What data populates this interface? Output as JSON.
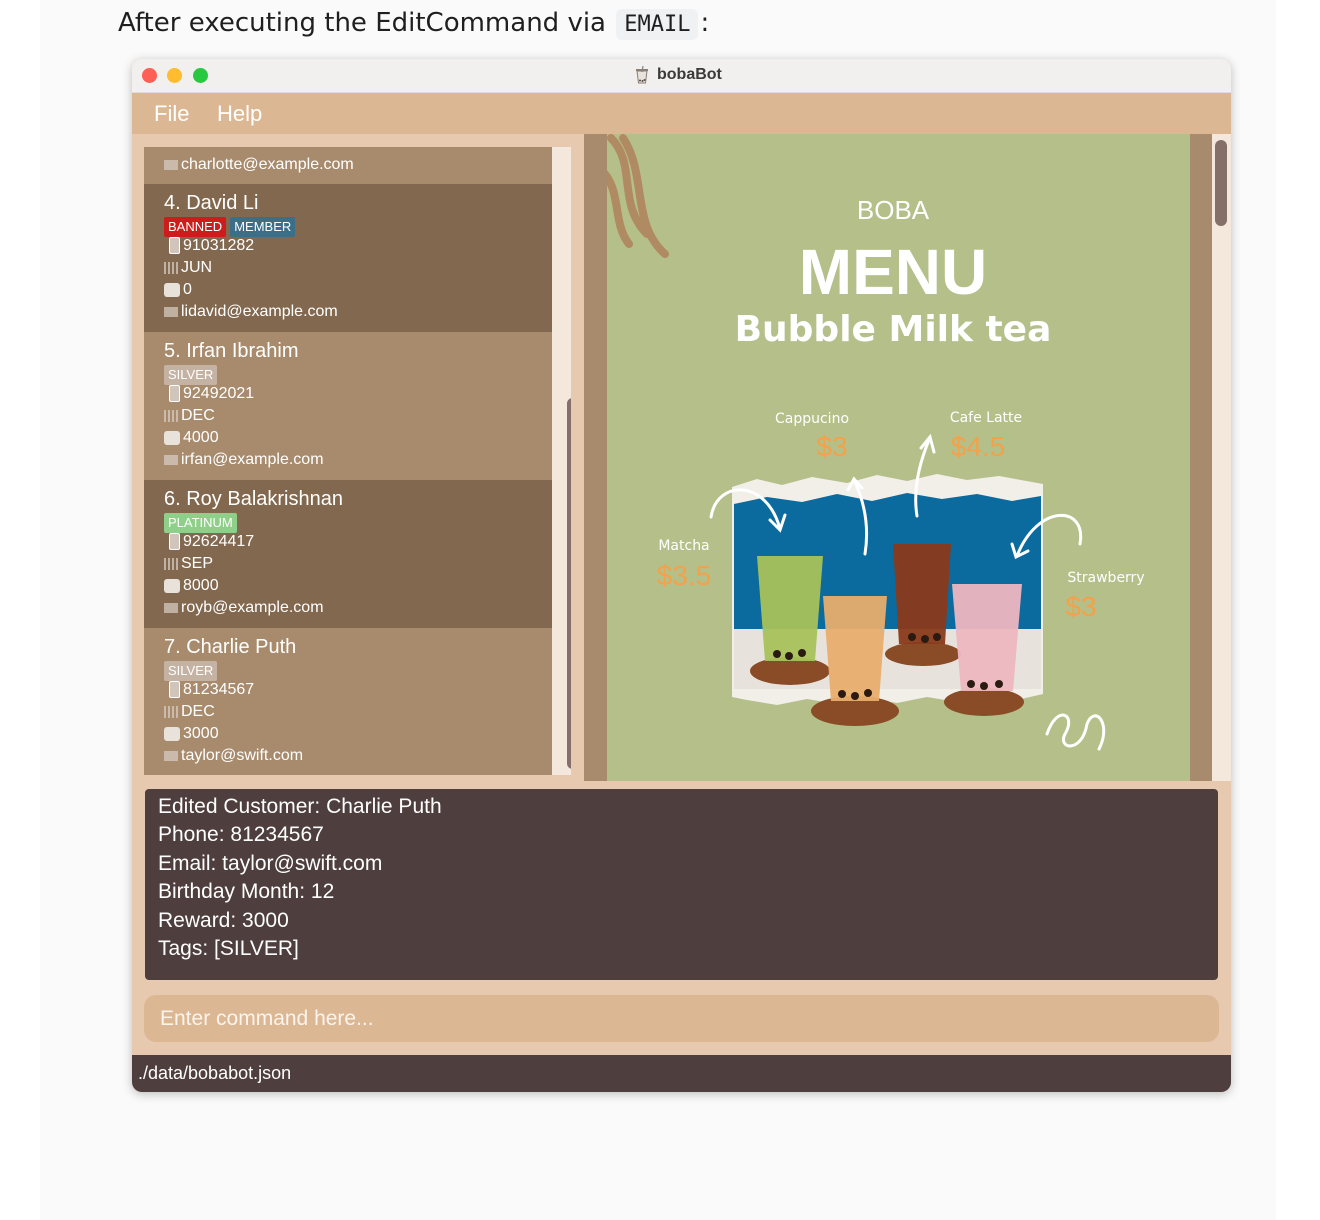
{
  "doc": {
    "heading_before": "After executing the EditCommand via ",
    "heading_code": "EMAIL",
    "heading_after": ":"
  },
  "window": {
    "title": "bobaBot"
  },
  "menubar": {
    "file": "File",
    "help": "Help"
  },
  "list": {
    "partial_top": {
      "email": "charlotte@example.com"
    },
    "customers": [
      {
        "name": "4.  David Li",
        "tags": [
          "BANNED",
          "MEMBER"
        ],
        "phone": "91031282",
        "birthday": "JUN",
        "reward": "0",
        "email": "lidavid@example.com"
      },
      {
        "name": "5.  Irfan Ibrahim",
        "tags": [
          "SILVER"
        ],
        "phone": "92492021",
        "birthday": "DEC",
        "reward": "4000",
        "email": "irfan@example.com"
      },
      {
        "name": "6.  Roy Balakrishnan",
        "tags": [
          "PLATINUM"
        ],
        "phone": "92624417",
        "birthday": "SEP",
        "reward": "8000",
        "email": "royb@example.com"
      },
      {
        "name": "7.  Charlie Puth",
        "tags": [
          "SILVER"
        ],
        "phone": "81234567",
        "birthday": "DEC",
        "reward": "3000",
        "email": "taylor@swift.com"
      }
    ]
  },
  "poster": {
    "top": "BOBA",
    "title": "MENU",
    "subtitle": "Bubble Milk tea",
    "items": [
      {
        "name": "Cappucino",
        "price": "$3"
      },
      {
        "name": "Cafe Latte",
        "price": "$4.5"
      },
      {
        "name": "Matcha",
        "price": "$3.5"
      },
      {
        "name": "Strawberry",
        "price": "$3"
      }
    ]
  },
  "result": {
    "lines": [
      "Edited Customer: Charlie Puth",
      "Phone: 81234567",
      "Email: taylor@swift.com",
      "Birthday Month: 12",
      "Reward: 3000",
      "Tags: [SILVER]"
    ]
  },
  "command": {
    "placeholder": "Enter command here..."
  },
  "status": {
    "path": "./data/bobabot.json"
  },
  "colors": {
    "menubar": "#dcb793",
    "result_bg": "#4e3e3e",
    "card_light": "#a88b6d",
    "card_dark": "#82684e",
    "poster_bg": "#b5bf89",
    "price": "#f3a24a"
  }
}
